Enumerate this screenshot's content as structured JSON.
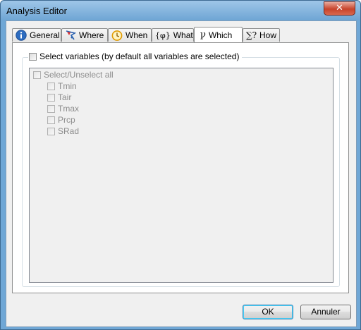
{
  "window": {
    "title": "Analysis Editor",
    "close_glyph": "✕"
  },
  "tabs": [
    {
      "label": "General",
      "icon": "info-icon",
      "active": false
    },
    {
      "label": "Where",
      "icon": "map-flag-icon",
      "active": false
    },
    {
      "label": "When",
      "icon": "clock-icon",
      "active": false
    },
    {
      "label": "What",
      "icon_text": "{φ}",
      "icon": "phi-braces-icon",
      "active": false
    },
    {
      "label": "Which",
      "icon_text": "ꝩ",
      "icon": "which-symbol-icon",
      "active": true
    },
    {
      "label": "How",
      "icon_text": "∑?",
      "icon": "sigma-icon",
      "active": false
    }
  ],
  "which": {
    "select_variables_label": "Select variables (by default all variables are selected)",
    "select_all_label": "Select/Unselect all",
    "variables": [
      "Tmin",
      "Tair",
      "Tmax",
      "Prcp",
      "SRad"
    ]
  },
  "buttons": {
    "ok": "OK",
    "cancel": "Annuler"
  },
  "colors": {
    "title_bar": "#6ea5d4",
    "close_button": "#c7432b",
    "default_button_focus": "#48d3fb"
  }
}
